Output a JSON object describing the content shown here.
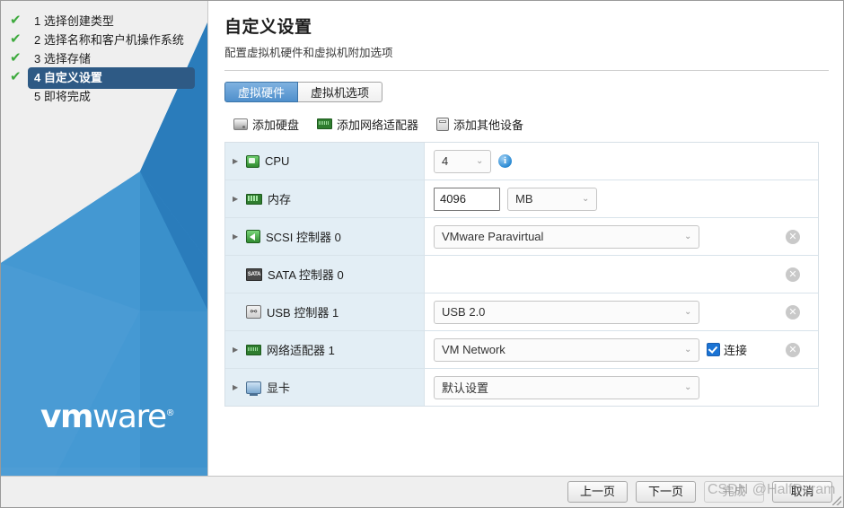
{
  "sidebar": {
    "steps": [
      {
        "num": "1",
        "label": "1 选择创建类型",
        "done": true,
        "active": false
      },
      {
        "num": "2",
        "label": "2 选择名称和客户机操作系统",
        "done": true,
        "active": false
      },
      {
        "num": "3",
        "label": "3 选择存储",
        "done": true,
        "active": false
      },
      {
        "num": "4",
        "label": "4 自定义设置",
        "done": true,
        "active": true
      },
      {
        "num": "5",
        "label": "5 即将完成",
        "done": false,
        "active": false
      }
    ],
    "tick_glyph": "✔",
    "logo": {
      "bold": "vm",
      "light": "ware",
      "reg": "®"
    },
    "accent_color": "#2e5a85",
    "brand_blue": "#2f86c8"
  },
  "header": {
    "title": "自定义设置",
    "subtitle": "配置虚拟机硬件和虚拟机附加选项"
  },
  "tabs": [
    {
      "label": "虚拟硬件",
      "active": true
    },
    {
      "label": "虚拟机选项",
      "active": false
    }
  ],
  "toolbar": [
    {
      "label": "添加硬盘",
      "icon": "hard-disk-icon"
    },
    {
      "label": "添加网络适配器",
      "icon": "network-adapter-icon"
    },
    {
      "label": "添加其他设备",
      "icon": "other-device-icon"
    }
  ],
  "hardware_rows": [
    {
      "name": "CPU",
      "label": "CPU",
      "icon": "cpu-icon",
      "expandable": true,
      "control": "select",
      "value": "4",
      "has_info": true,
      "removable": false
    },
    {
      "name": "memory",
      "label": "内存",
      "icon": "memory-icon",
      "expandable": true,
      "control": "text-unit",
      "value": "4096",
      "unit": "MB",
      "removable": false
    },
    {
      "name": "scsi-controller-0",
      "label": "SCSI 控制器 0",
      "icon": "scsi-controller-icon",
      "expandable": true,
      "control": "select-wide",
      "value": "VMware Paravirtual",
      "removable": true
    },
    {
      "name": "sata-controller-0",
      "label": "SATA 控制器 0",
      "icon": "sata-controller-icon",
      "expandable": false,
      "control": "none",
      "value": "",
      "removable": true
    },
    {
      "name": "usb-controller-1",
      "label": "USB 控制器 1",
      "icon": "usb-controller-icon",
      "expandable": false,
      "control": "select-wide",
      "value": "USB 2.0",
      "removable": true
    },
    {
      "name": "network-adapter-1",
      "label": "网络适配器 1",
      "icon": "network-adapter-icon",
      "expandable": true,
      "control": "select-wide",
      "value": "VM Network",
      "checkbox_label": "连接",
      "checkbox_checked": true,
      "removable": true
    },
    {
      "name": "video-card",
      "label": "显卡",
      "icon": "video-card-icon",
      "expandable": true,
      "control": "select-wide",
      "value": "默认设置",
      "removable": false
    }
  ],
  "footer": {
    "buttons": [
      {
        "label": "上一页",
        "name": "back-button",
        "disabled": false
      },
      {
        "label": "下一页",
        "name": "next-button",
        "disabled": false
      },
      {
        "label": "完成",
        "name": "finish-button",
        "disabled": true
      },
      {
        "label": "取消",
        "name": "cancel-button",
        "disabled": false
      }
    ]
  },
  "watermark": "CSDN @HalfDeram",
  "glyphs": {
    "caret_down": "⌄",
    "twisty_right": "▶",
    "close": "✕",
    "info": "i",
    "sata": "SATA",
    "usb": "⚯"
  }
}
